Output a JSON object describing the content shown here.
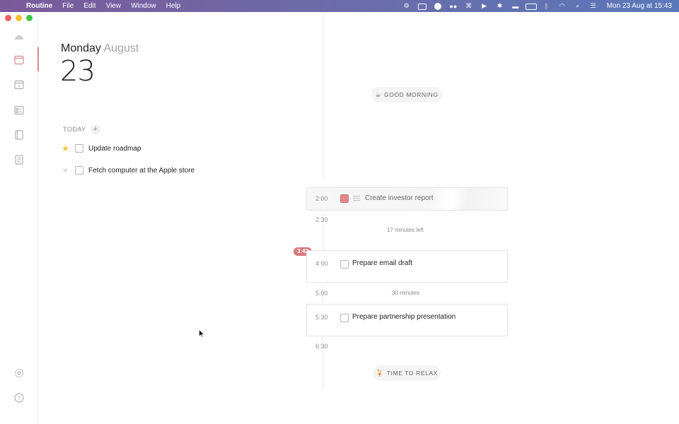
{
  "menubar": {
    "app_name": "Routine",
    "menus": [
      "File",
      "Edit",
      "View",
      "Window",
      "Help"
    ],
    "clock": "Mon 23 Aug at  15:43"
  },
  "date": {
    "day_name": "Monday",
    "month": "August",
    "day_number": "23"
  },
  "today": {
    "label": "TODAY",
    "add_label": "+",
    "tasks": [
      {
        "label": "Update roadmap",
        "starred": true
      },
      {
        "label": "Fetch computer at the Apple store",
        "starred": false
      }
    ]
  },
  "timeline": {
    "morning_label": "GOOD MORNING",
    "morning_emoji": "☕",
    "relax_label": "TIME TO RELAX",
    "relax_emoji": "🍹",
    "now_time": "3:42",
    "events": [
      {
        "start": "2:00",
        "end": "2:30",
        "label": "Create investor report",
        "active": true
      },
      {
        "start": "4:00",
        "end": "5:00",
        "label": "Prepare email draft",
        "active": false
      },
      {
        "start": "5:30",
        "end": "6:30",
        "label": "Prepare partnership presentation",
        "active": false
      }
    ],
    "gap_1": "17 minutes left",
    "gap_2": "30 minutes"
  },
  "colors": {
    "accent": "#d6787b",
    "event_swatch": "#e0898c",
    "star": "#f4c543"
  }
}
